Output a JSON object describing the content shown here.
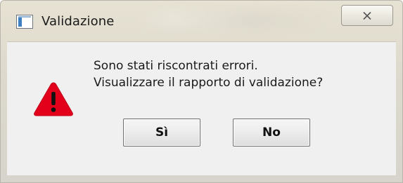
{
  "window": {
    "title": "Validazione",
    "icon": "app-window-icon",
    "close_icon": "close-icon"
  },
  "message": {
    "line1": "Sono stati riscontrati errori.",
    "line2": "Visualizzare il rapporto di validazione?",
    "icon": "warning-icon",
    "icon_color": "#e3001b"
  },
  "buttons": {
    "yes_label": "Sì",
    "no_label": "No"
  }
}
